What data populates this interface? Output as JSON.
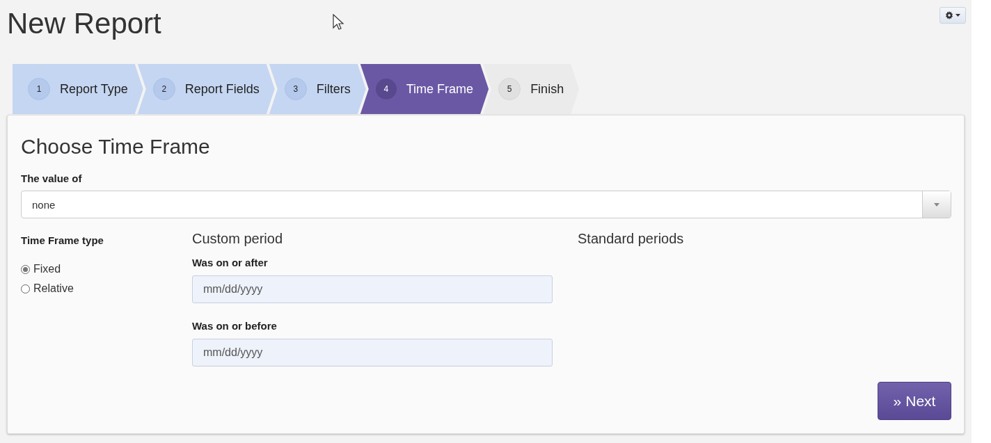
{
  "page_title": "New Report",
  "steps": [
    {
      "number": "1",
      "label": "Report Type",
      "kind": "done"
    },
    {
      "number": "2",
      "label": "Report Fields",
      "kind": "done"
    },
    {
      "number": "3",
      "label": "Filters",
      "kind": "done"
    },
    {
      "number": "4",
      "label": "Time Frame",
      "kind": "current"
    },
    {
      "number": "5",
      "label": "Finish",
      "kind": "pending"
    }
  ],
  "panel": {
    "title": "Choose Time Frame",
    "value_of": {
      "label": "The value of",
      "value": "none"
    },
    "time_frame_type": {
      "label": "Time Frame type",
      "options": [
        {
          "label": "Fixed",
          "selected": true
        },
        {
          "label": "Relative",
          "selected": false
        }
      ]
    },
    "custom_period": {
      "heading": "Custom period",
      "fields": [
        {
          "label": "Was on or after",
          "placeholder": "mm/dd/yyyy"
        },
        {
          "label": "Was on or before",
          "placeholder": "mm/dd/yyyy"
        }
      ]
    },
    "standard_periods": {
      "heading": "Standard periods"
    },
    "next_button": {
      "icon": "»",
      "label": "Next"
    }
  }
}
